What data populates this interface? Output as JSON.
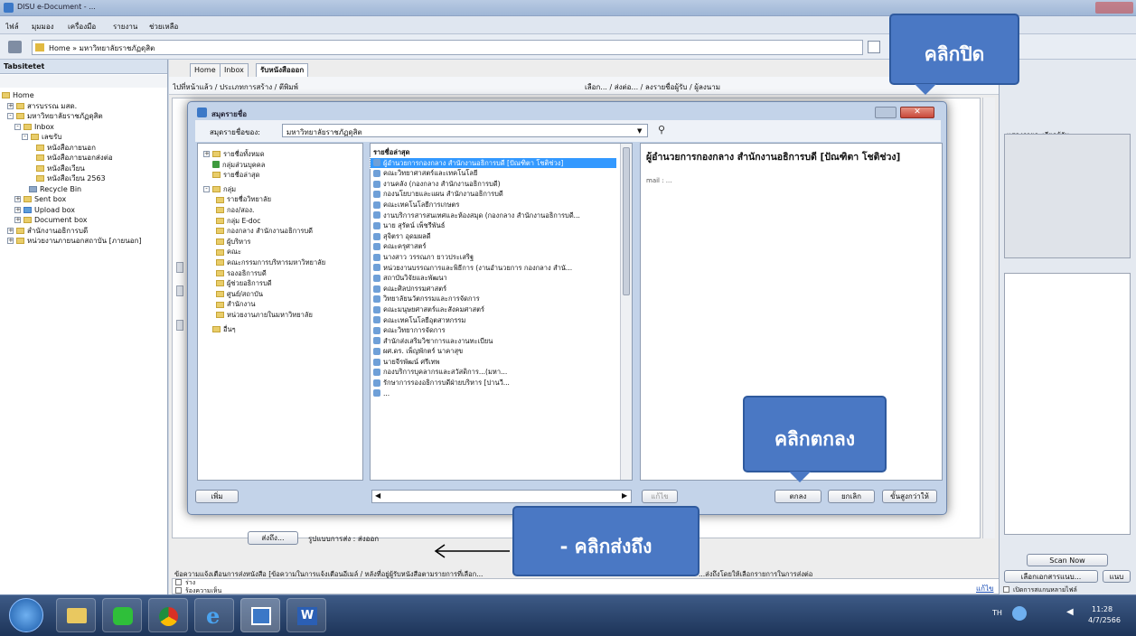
{
  "app": {
    "title": "DISU e-Document - ..."
  },
  "menu": [
    "ไฟล์",
    "มุมมอง",
    "เครื่องมือ",
    "รายงาน",
    "ช่วยเหลือ"
  ],
  "address": {
    "value": "Home » มหาวิทยาลัยราชภัฏดุสิต"
  },
  "left_pane": {
    "title": "Tabsitetet",
    "tree": [
      {
        "label": "Home",
        "level": 0
      },
      {
        "label": "สารบรรณ มสด.",
        "level": 1
      },
      {
        "label": "มหาวิทยาลัยราชภัฏดุสิต",
        "level": 1
      },
      {
        "label": "Inbox",
        "level": 2
      },
      {
        "label": "เลขรับ",
        "level": 3
      },
      {
        "label": "หนังสือภายนอก",
        "level": 4
      },
      {
        "label": "หนังสือภายนอกส่งต่อ",
        "level": 4
      },
      {
        "label": "หนังสือเวียน",
        "level": 4
      },
      {
        "label": "หนังสือเวียน 2563",
        "level": 4
      },
      {
        "label": "Recycle Bin",
        "level": 3
      },
      {
        "label": "Sent box",
        "level": 2
      },
      {
        "label": "Upload box",
        "level": 2
      },
      {
        "label": "Document box",
        "level": 2
      },
      {
        "label": "สำนักงานอธิการบดี",
        "level": 1
      },
      {
        "label": "หน่วยงานภายนอกสถาบัน [ภายนอก]",
        "level": 1
      }
    ]
  },
  "tabs": [
    "Home",
    "Inbox",
    "รับหนังสือออก"
  ],
  "toolbar2": {
    "left": "ไปที่หน้าแล้ว / ประเภทการสร้าง / ตีพิมพ์",
    "right": "เลือก... / ส่งต่อ... / ลงรายชื่อผู้รับ / ผู้ลงนาม"
  },
  "dialog": {
    "title": "สมุดรายชื่อ",
    "search_label": "สมุดรายชื่อของ:",
    "search_value": "มหาวิทยาลัยราชภัฏดุสิต",
    "tree_items": [
      {
        "label": "รายชื่อทั้งหมด",
        "level": 0,
        "icon": "folder"
      },
      {
        "label": "กลุ่มส่วนบุคคล",
        "level": 0,
        "icon": "group"
      },
      {
        "label": "รายชื่อล่าสุด",
        "level": 0,
        "icon": "folder"
      },
      {
        "label": "กลุ่ม",
        "level": 0,
        "icon": "folder"
      },
      {
        "label": "รายชื่อวิทยาลัย",
        "level": 1,
        "icon": "folder"
      },
      {
        "label": "กอง/สอง.",
        "level": 1,
        "icon": "folder"
      },
      {
        "label": "กลุ่ม E-doc",
        "level": 1,
        "icon": "folder"
      },
      {
        "label": "กองกลาง สำนักงานอธิการบดี",
        "level": 1,
        "icon": "folder"
      },
      {
        "label": "ผู้บริหาร",
        "level": 1,
        "icon": "folder"
      },
      {
        "label": "คณะ",
        "level": 1,
        "icon": "folder"
      },
      {
        "label": "คณะกรรมการบริหารมหาวิทยาลัย",
        "level": 1,
        "icon": "folder"
      },
      {
        "label": "รองอธิการบดี",
        "level": 1,
        "icon": "folder"
      },
      {
        "label": "ผู้ช่วยอธิการบดี",
        "level": 1,
        "icon": "folder"
      },
      {
        "label": "ศูนย์/สถาบัน",
        "level": 1,
        "icon": "folder"
      },
      {
        "label": "สำนักงาน",
        "level": 1,
        "icon": "folder"
      },
      {
        "label": "หน่วยงานภายในมหาวิทยาลัย",
        "level": 1,
        "icon": "folder"
      },
      {
        "label": "อื่นๆ",
        "level": 0,
        "icon": "folder"
      }
    ],
    "list_header": "รายชื่อล่าสุด",
    "list_items": [
      "ผู้อำนวยการกองกลาง สำนักงานอธิการบดี [ปัณฑิตา โชติช่วง]",
      "คณะวิทยาศาสตร์และเทคโนโลยี",
      "งานคลัง (กองกลาง สำนักงานอธิการบดี)",
      "กองนโยบายและแผน สำนักงานอธิการบดี",
      "คณะเทคโนโลยีการเกษตร",
      "งานบริการสารสนเทศและห้องสมุด (กองกลาง สำนักงานอธิการบดี...",
      "นาย สุรัตน์ เพ็ชรีพันธ์",
      "สุจิตรา อุดมผลดี",
      "คณะครุศาสตร์",
      "นางสาว วรรณภา ยาวประเสริฐ",
      "หน่วยงานบรรณการและพิธีการ (งานอำนวยการ กองกลาง สำนั...",
      "สถาบันวิจัยและพัฒนา",
      "คณะศิลปกรรมศาสตร์",
      "วิทยาลัยนวัตกรรมและการจัดการ",
      "คณะมนุษยศาสตร์และสังคมศาสตร์",
      "คณะเทคโนโลยีอุตสาหกรรม",
      "คณะวิทยาการจัดการ",
      "สำนักส่งเสริมวิชาการและงานทะเบียน",
      "ผศ.ดร. เพ็ญพักตร์ นาคาสุข",
      "นายจีรพัฒน์ ศรีเทพ",
      "กองบริการบุคลากรและสวัสดิการ...(มหา...",
      "รักษาการรองอธิการบดีฝ่ายบริหาร [ปานวี...",
      "..."
    ],
    "detail_name": "ผู้อำนวยการกองกลาง สำนักงานอธิการบดี [ปัณฑิตา โชติช่วง]",
    "detail_sub": "mail : ...",
    "buttons": {
      "add": "เพิ่ม",
      "remove": "แก้ไข",
      "ok": "ตกลง",
      "cancel": "ยกเลิก",
      "advanced": "ขั้นสูงกว่าให้"
    }
  },
  "bottom": {
    "send_to_button": "ส่งถึง...",
    "send_format": "รูปแบบการส่ง : ส่งออก",
    "note": "ข้อความแจ้งเตือนการส่งหนังสือ [ข้อความในการแจ้งเตือนอีเมล์ / หลังที่อยู่ผู้รับหนังสือตามรายการที่เลือก...",
    "note_right": "...ส่งถึงโดยให้เลือกรายการในการส่งต่อ",
    "check1": "ร่าง",
    "check2": "ร้องความเห็น",
    "print_link": "แก้ไข"
  },
  "right_pane": {
    "title": "แสดงรายละเอียดผู้รับ",
    "scan_button": "Scan Now",
    "select_button": "เลือกเอกสารแนบ...",
    "add_button": "แนบ",
    "checkbox": "เปิดการสแกนหลายไฟล์"
  },
  "callouts": {
    "close": "คลิกปิด",
    "ok": "คลิกตกลง",
    "send": "- คลิกส่งถึง"
  },
  "clock": {
    "time": "11:28",
    "date": "4/7/2566"
  }
}
